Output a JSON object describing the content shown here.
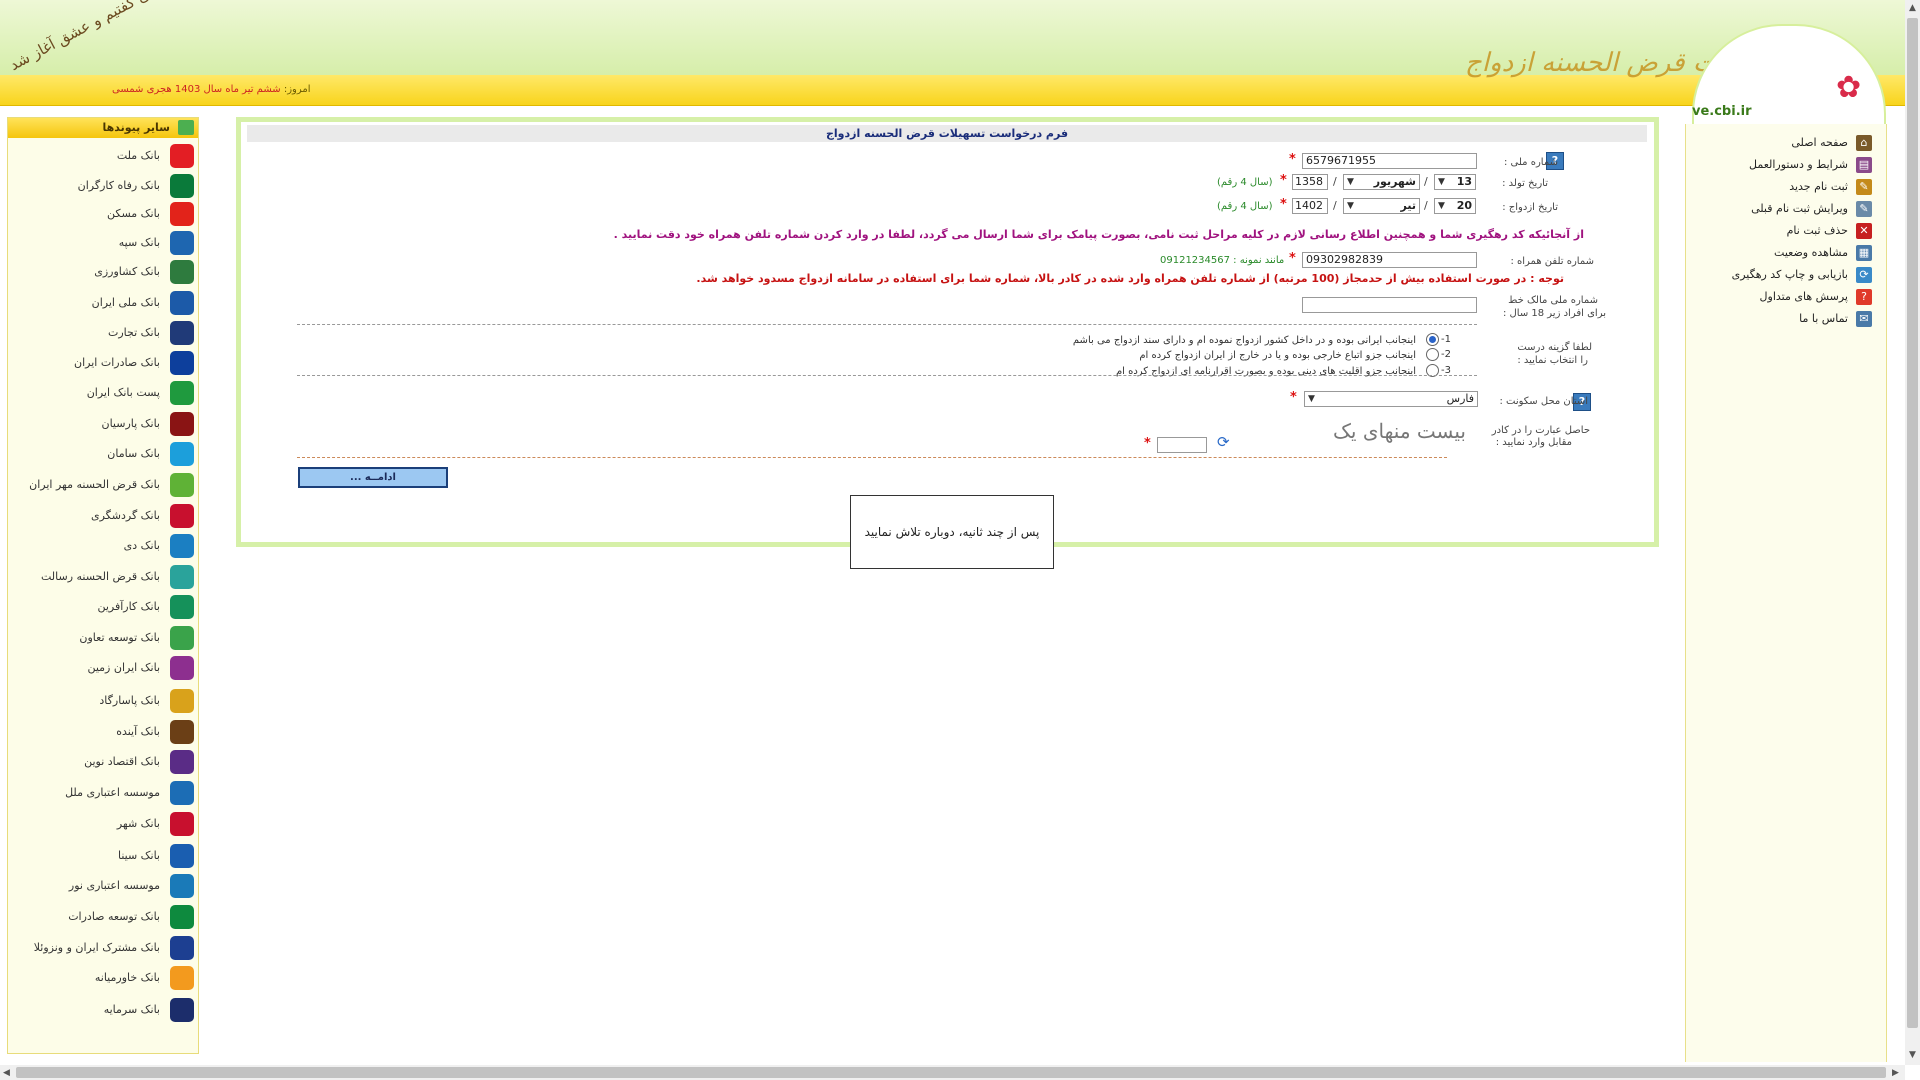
{
  "header": {
    "site_title": "سامانه تسهیلات قرض الحسنه ازدواج",
    "site_url": "ve.cbi.ir",
    "date_prefix": "امروز:",
    "date_value": "ششم تیر ماه سال 1403 هجری شمسی",
    "corner_text": "یا علی گفتیم و عشق آغاز شد"
  },
  "left_sidebar": {
    "title": "سایر پیوندها",
    "banks": [
      {
        "label": "بانک ملت",
        "color": "#e31e24"
      },
      {
        "label": "بانک رفاه کارگران",
        "color": "#0a7a3a"
      },
      {
        "label": "بانک مسکن",
        "color": "#e2231a"
      },
      {
        "label": "بانک سپه",
        "color": "#1e66b0"
      },
      {
        "label": "بانک کشاورزی",
        "color": "#2e7b3e"
      },
      {
        "label": "بانک ملی ایران",
        "color": "#1c5aa8"
      },
      {
        "label": "بانک تجارت",
        "color": "#203a78"
      },
      {
        "label": "بانک صادرات ایران",
        "color": "#0d3f9c"
      },
      {
        "label": "پست بانک ایران",
        "color": "#1f9a3e"
      },
      {
        "label": "بانک پارسیان",
        "color": "#8a1414"
      },
      {
        "label": "بانک سامان",
        "color": "#1c9fdb"
      },
      {
        "label": "بانک قرض الحسنه مهر ایران",
        "color": "#5fb236"
      },
      {
        "label": "بانک گردشگری",
        "color": "#c8102e"
      },
      {
        "label": "بانک دی",
        "color": "#1b7fc2"
      },
      {
        "label": "بانک قرض الحسنه رسالت",
        "color": "#2aa39b"
      },
      {
        "label": "بانک کارآفرین",
        "color": "#15915a"
      },
      {
        "label": "بانک توسعه تعاون",
        "color": "#3aa34a"
      },
      {
        "label": "بانک ایران زمین",
        "color": "#8d2f8f"
      },
      {
        "label": "بانک پاسارگاد",
        "color": "#d9a21b"
      },
      {
        "label": "بانک آینده",
        "color": "#6b3f16"
      },
      {
        "label": "بانک اقتصاد نوین",
        "color": "#5a2c86"
      },
      {
        "label": "موسسه اعتباری ملل",
        "color": "#1c6db5"
      },
      {
        "label": "بانک شهر",
        "color": "#c8102e"
      },
      {
        "label": "بانک سینا",
        "color": "#1a5eb0"
      },
      {
        "label": "موسسه اعتباری نور",
        "color": "#1a7ab8"
      },
      {
        "label": "بانک توسعه صادرات",
        "color": "#0e8a3e"
      },
      {
        "label": "بانک مشترک ایران و ونزوئلا",
        "color": "#1d3f91"
      },
      {
        "label": "بانک خاورمیانه",
        "color": "#f39a1e"
      },
      {
        "label": "بانک سرمایه",
        "color": "#1c2d6b"
      }
    ]
  },
  "right_menu": {
    "items": [
      {
        "label": "صفحه اصلی",
        "icon": "home-icon",
        "color": "#7a5a2a"
      },
      {
        "label": "شرایط و دستورالعمل",
        "icon": "book-icon",
        "color": "#8a4a8a"
      },
      {
        "label": "ثبت نام جدید",
        "icon": "edit-icon",
        "color": "#c48a1a"
      },
      {
        "label": "ویرایش ثبت نام قبلی",
        "icon": "edit-doc-icon",
        "color": "#6a8aa8"
      },
      {
        "label": "حذف ثبت نام",
        "icon": "delete-icon",
        "color": "#c62020"
      },
      {
        "label": "مشاهده وضعیت",
        "icon": "view-icon",
        "color": "#4a7aa8"
      },
      {
        "label": "بازیابی و چاپ کد رهگیری",
        "icon": "refresh-icon",
        "color": "#3a8ac8"
      },
      {
        "label": "پرسش های متداول",
        "icon": "question-icon",
        "color": "#e03a2a"
      },
      {
        "label": "تماس با ما",
        "icon": "contact-icon",
        "color": "#4a7aa8"
      }
    ]
  },
  "form": {
    "title": "فرم درخواست تسهیلات قرض الحسنه ازدواج",
    "national_id_label": "شماره ملی :",
    "national_id_value": "6579671955",
    "birth_label": "تاریخ تولد :",
    "birth_day": "13",
    "birth_month": "شهریور",
    "birth_year": "1358",
    "year_hint": "(سال 4 رقم)",
    "marriage_label": "تاریخ ازدواج :",
    "marriage_day": "20",
    "marriage_month": "تیر",
    "marriage_year": "1402",
    "sms_notice": "از آنجائیکه کد رهگیری شما و همچنین اطلاع رسانی لازم در کلیه مراحل ثبت نامی، بصورت پیامک برای شما ارسال می گردد، لطفا در وارد کردن شماره تلفن همراه خود دقت نمایید .",
    "mobile_label": "شماره تلفن همراه :",
    "mobile_value": "09302982839",
    "mobile_example": "مانند نمونه : 09121234567",
    "mobile_warning": "توجه : در صورت استفاده بیش از حدمجاز (100 مرتبه) از شماره تلفن همراه وارد شده در کادر بالا، شماره شما برای استفاده در سامانه ازدواج مسدود خواهد شد.",
    "owner_id_label_1": "شماره ملی مالک خط",
    "owner_id_label_2": "برای افراد زیر 18 سال :",
    "owner_id_value": "",
    "choose_label_1": "لطفا گزینه درست",
    "choose_label_2": "را انتخاب نمایید :",
    "options": [
      {
        "num": "1-",
        "text": "اینجانب ایرانی بوده و در داخل کشور ازدواج نموده ام و دارای سند ازدواج می باشم",
        "selected": true
      },
      {
        "num": "2-",
        "text": "اینجانب جزو اتباع خارجی بوده و یا در خارج از ایران ازدواج کرده ام",
        "selected": false
      },
      {
        "num": "3-",
        "text": "اینجانب جزو اقلیت های دینی بوده و بصورت اقرارنامه ای ازدواج کرده ام",
        "selected": false
      }
    ],
    "province_label": "استان محل سکونت :",
    "province_value": "فارس",
    "captcha_label_1": "حاصل عبارت را در کادر",
    "captcha_label_2": "مقابل وارد نمایید :",
    "captcha_text": "بیست منهای یک",
    "captcha_value": "",
    "submit_label": "ادامــه ...",
    "help_mark": "?",
    "required_mark": "*",
    "slash": "/"
  },
  "popup": {
    "message": "پس از چند ثانیه، دوباره تلاش نمایید"
  }
}
